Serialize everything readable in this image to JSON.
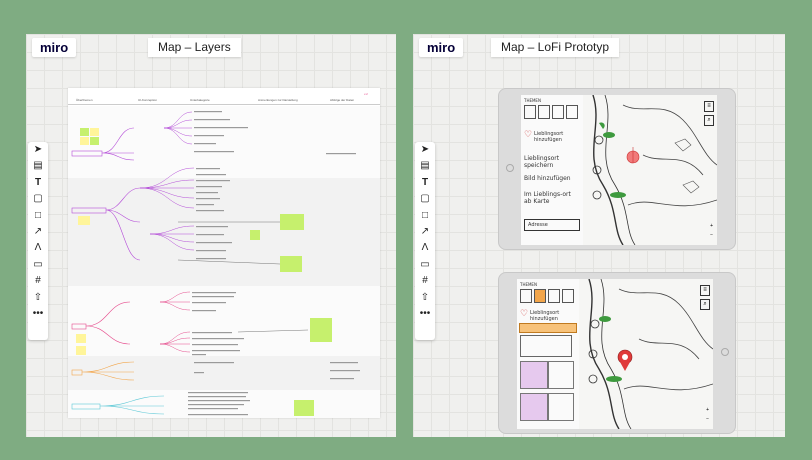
{
  "left_panel": {
    "brand": "miro",
    "title": "Map – Layers",
    "toolbar": [
      "cursor-icon",
      "frame-icon",
      "text-icon",
      "sticky-note-icon",
      "shape-icon",
      "arrow-icon",
      "pen-icon",
      "comment-icon",
      "grid-icon",
      "upload-icon",
      "more-icon"
    ],
    "columns": [
      "Überthemen",
      "UI-Konzeption",
      "Unterkategorie",
      "Anmerkungen zur Darstellung",
      "Abfolge der Daten"
    ],
    "corner_label": "v.2"
  },
  "right_panel": {
    "brand": "miro",
    "title": "Map – LoFi Prototyp",
    "toolbar": [
      "cursor-icon",
      "frame-icon",
      "text-icon",
      "sticky-note-icon",
      "shape-icon",
      "arrow-icon",
      "pen-icon",
      "comment-icon",
      "grid-icon",
      "upload-icon",
      "more-icon"
    ],
    "top_tablet": {
      "lines": [
        "THEMEN",
        "Lieblingsort hinzufügen",
        "Lieblingsort speichern",
        "Bild hinzufügen",
        "Im Lieblings-ort ab Karte",
        "Adresse"
      ]
    },
    "bottom_tablet": {
      "lines": [
        "THEMEN",
        "Lieblingsort hinzufügen"
      ]
    }
  },
  "colors": {
    "background": "#7fac82",
    "panel": "#f0f0ee",
    "sticky_green": "#c6f06d",
    "sticky_yellow": "#fff59a",
    "accent_purple": "#b44cd8",
    "accent_pink": "#e64b8c",
    "accent_orange": "#f3a64b",
    "accent_teal": "#5cc8d6",
    "pin_red": "#e03a3a"
  }
}
